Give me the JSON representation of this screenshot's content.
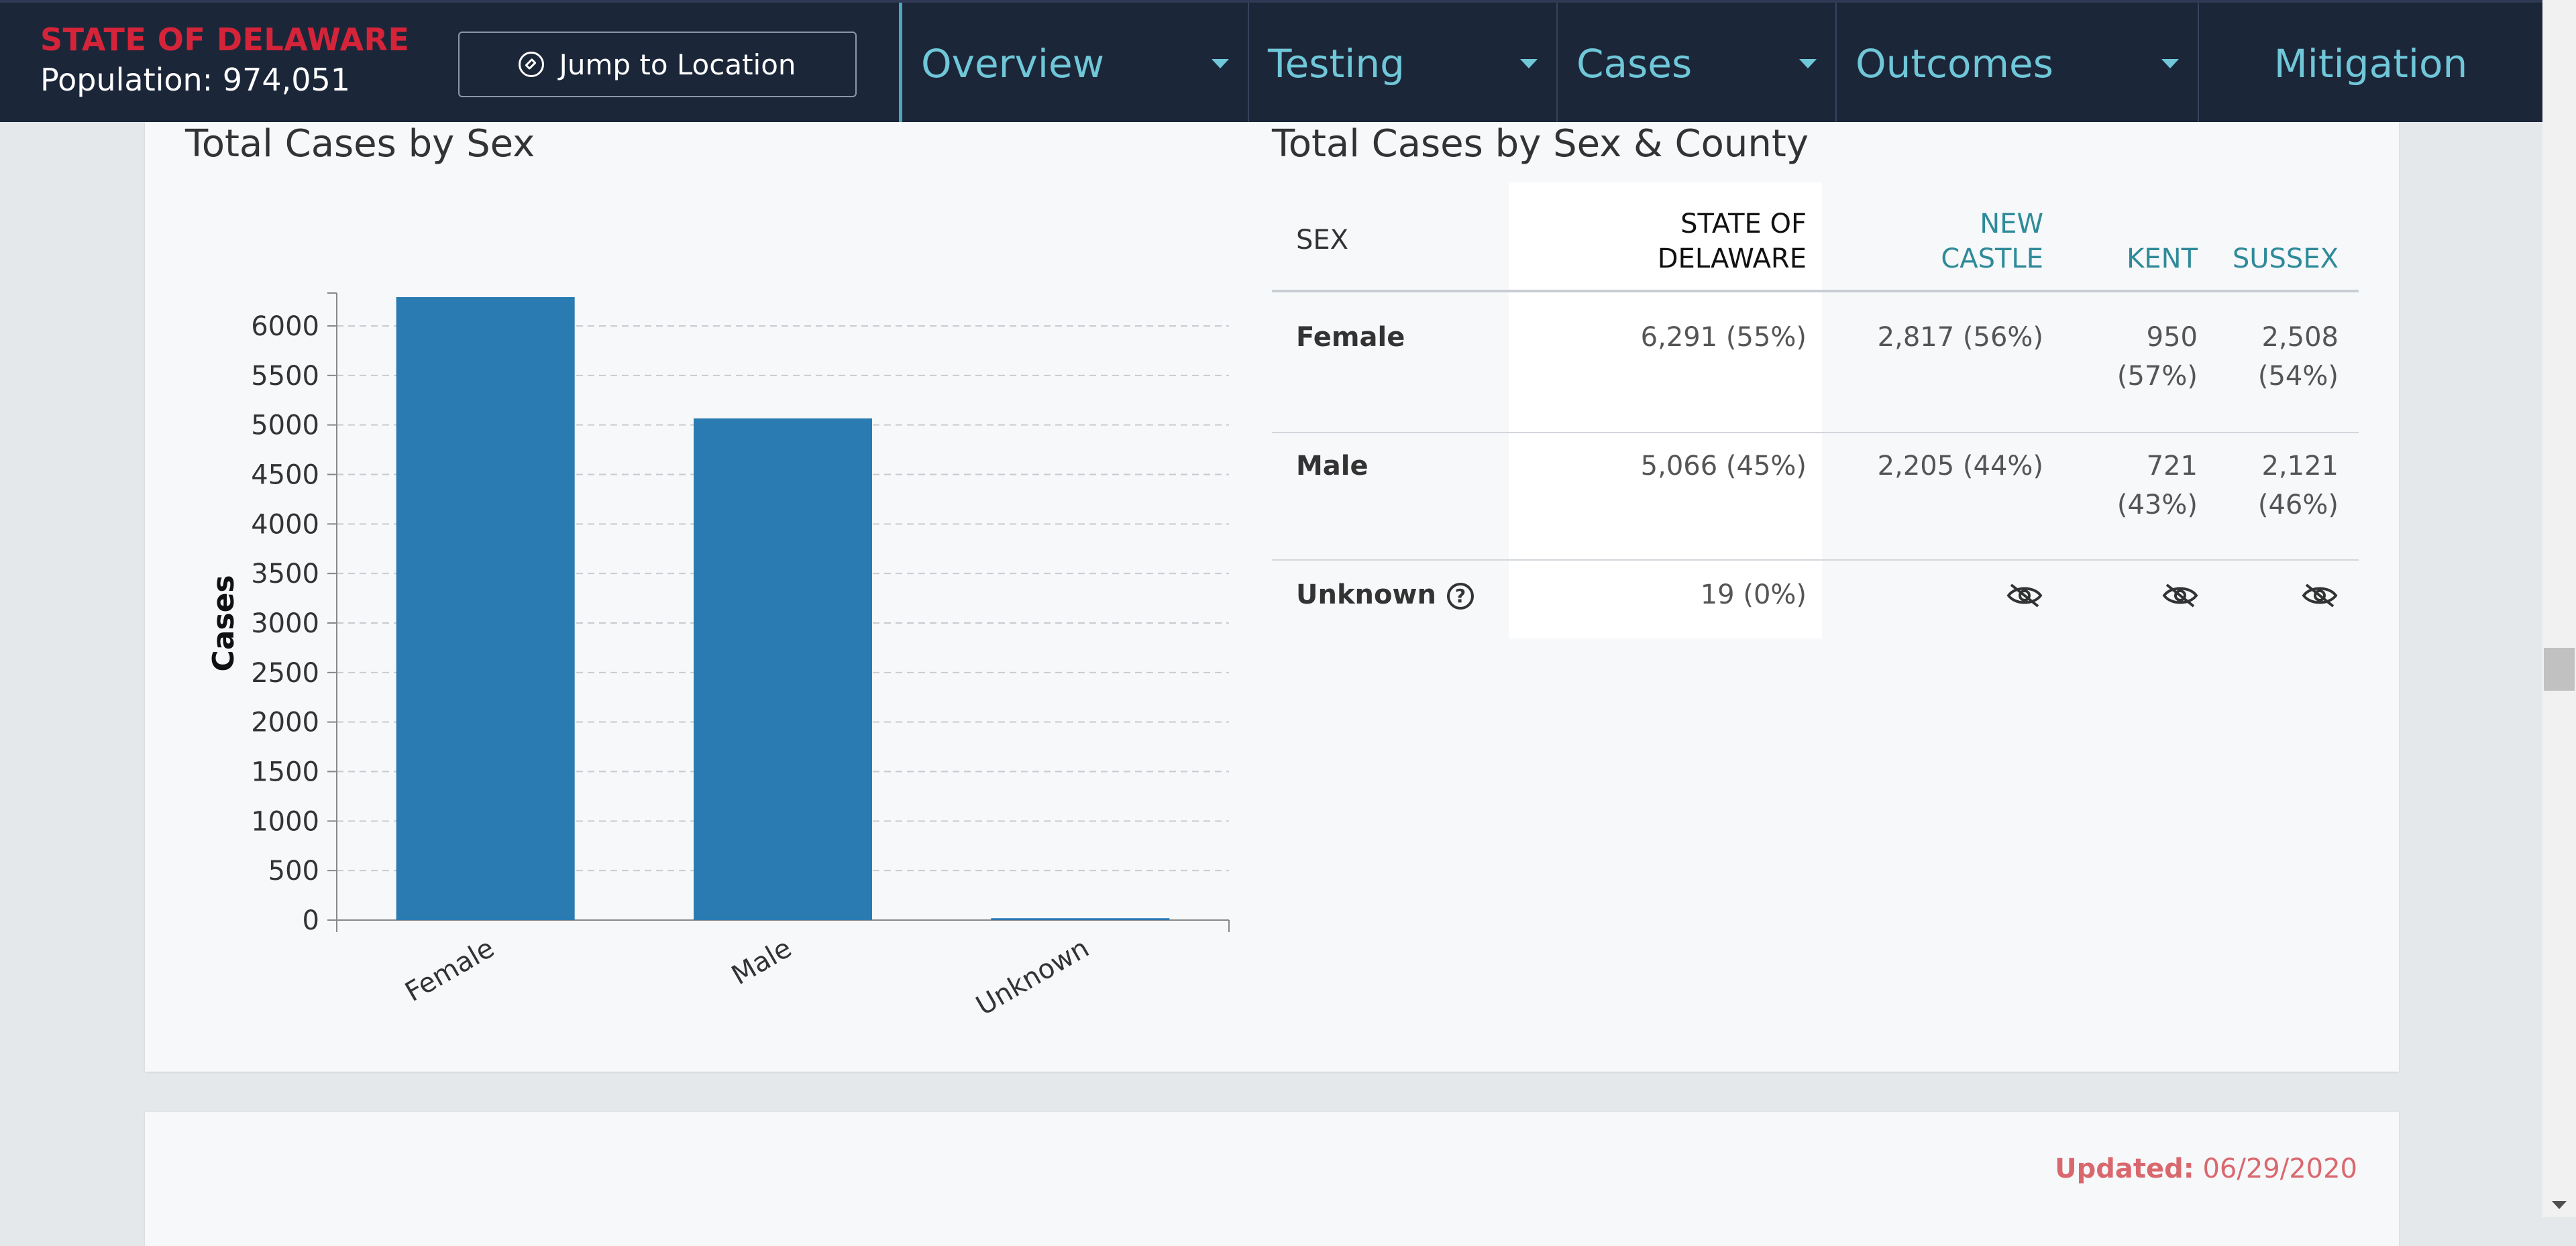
{
  "header": {
    "state_name": "STATE OF DELAWARE",
    "population": "Population: 974,051",
    "jump_button": "Jump to Location",
    "tabs": [
      {
        "label": "Overview",
        "has_menu": true
      },
      {
        "label": "Testing",
        "has_menu": true
      },
      {
        "label": "Cases",
        "has_menu": true
      },
      {
        "label": "Outcomes",
        "has_menu": true
      },
      {
        "label": "Mitigation",
        "has_menu": false
      }
    ]
  },
  "chart_card": {
    "title": "Total Cases by Sex",
    "table_title": "Total Cases by Sex & County"
  },
  "chart_data": {
    "type": "bar",
    "title": "Total Cases by Sex",
    "xlabel": "",
    "ylabel": "Cases",
    "categories": [
      "Female",
      "Male",
      "Unknown"
    ],
    "values": [
      6291,
      5066,
      19
    ],
    "ylim": [
      0,
      6000
    ],
    "yticks": [
      0,
      500,
      1000,
      1500,
      2000,
      2500,
      3000,
      3500,
      4000,
      4500,
      5000,
      5500,
      6000
    ],
    "grid": true,
    "bar_color": "#2b7bb3"
  },
  "table": {
    "headers": {
      "sex": "SEX",
      "state_line1": "STATE OF",
      "state_line2": "DELAWARE",
      "new_castle_line1": "NEW",
      "new_castle_line2": "CASTLE",
      "kent": "KENT",
      "sussex": "SUSSEX"
    },
    "rows": [
      {
        "sex": "Female",
        "state": "6,291 (55%)",
        "new_castle": "2,817 (56%)",
        "kent_line1": "950",
        "kent_line2": "(57%)",
        "sussex_line1": "2,508",
        "sussex_line2": "(54%)"
      },
      {
        "sex": "Male",
        "state": "5,066 (45%)",
        "new_castle": "2,205 (44%)",
        "kent_line1": "721",
        "kent_line2": "(43%)",
        "sussex_line1": "2,121",
        "sussex_line2": "(46%)"
      },
      {
        "sex": "Unknown",
        "state": "19 (0%)",
        "help_icon": "?"
      }
    ]
  },
  "footer_card": {
    "updated_label": "Updated:",
    "updated_date": "06/29/2020"
  },
  "icons": {
    "jump": "compass-icon",
    "hidden": "eye-slash-icon",
    "help": "question-circle-icon"
  },
  "colors": {
    "nav_bg": "#1c2639",
    "state_name": "#d5243a",
    "nav_text": "#6fc7d8",
    "county_header": "#2f8a99",
    "updated": "#d9686e"
  }
}
